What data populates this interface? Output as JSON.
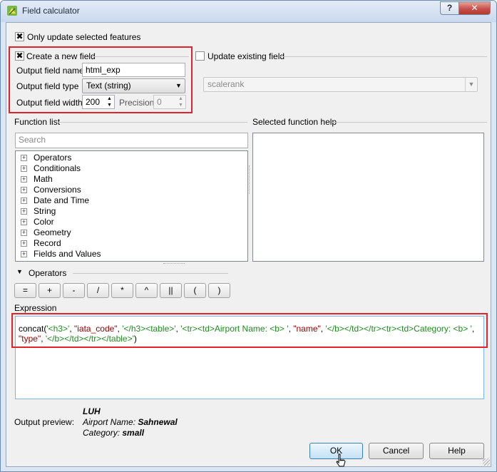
{
  "window": {
    "title": "Field calculator",
    "help_label": "?",
    "close_label": "✕"
  },
  "top": {
    "only_selected_label": "Only update selected features",
    "only_selected_checked": true
  },
  "new_field": {
    "create_label": "Create a new field",
    "checked": true,
    "name_label": "Output field name",
    "name_value": "html_exp",
    "type_label": "Output field type",
    "type_value": "Text (string)",
    "width_label": "Output field width",
    "width_value": "200",
    "precision_label": "Precision",
    "precision_value": "0"
  },
  "update_existing": {
    "label": "Update existing field",
    "checked": false,
    "field_value": "scalerank"
  },
  "function_list": {
    "title": "Function list",
    "search_placeholder": "Search",
    "items": [
      {
        "label": "Operators"
      },
      {
        "label": "Conditionals"
      },
      {
        "label": "Math"
      },
      {
        "label": "Conversions"
      },
      {
        "label": "Date and Time"
      },
      {
        "label": "String"
      },
      {
        "label": "Color"
      },
      {
        "label": "Geometry"
      },
      {
        "label": "Record"
      },
      {
        "label": "Fields and Values"
      }
    ]
  },
  "function_help": {
    "title": "Selected function help"
  },
  "operators": {
    "title": "Operators",
    "buttons": [
      "=",
      "+",
      "-",
      "/",
      "*",
      "^",
      "||",
      "(",
      ")"
    ]
  },
  "expression": {
    "title": "Expression",
    "tokens_line1": [
      {
        "t": "concat(",
        "k": "fn"
      },
      {
        "t": "'<h3>'",
        "k": "str"
      },
      {
        "t": ", ",
        "k": "fn"
      },
      {
        "t": "\"iata_code\"",
        "k": "ident"
      },
      {
        "t": ", ",
        "k": "fn"
      },
      {
        "t": "'</h3><table>'",
        "k": "str"
      },
      {
        "t": ", ",
        "k": "fn"
      },
      {
        "t": "'<tr><td>Airport Name: <b> '",
        "k": "str"
      },
      {
        "t": ", ",
        "k": "fn"
      },
      {
        "t": "\"name\"",
        "k": "ident"
      },
      {
        "t": ", ",
        "k": "fn"
      },
      {
        "t": "'</b></td></tr><tr><td>Category: <b> '",
        "k": "str"
      },
      {
        "t": ",",
        "k": "fn"
      }
    ],
    "tokens_line2": [
      {
        "t": "\"type\"",
        "k": "ident"
      },
      {
        "t": ", ",
        "k": "fn"
      },
      {
        "t": "'</b></td></tr></table>'",
        "k": "str"
      },
      {
        "t": ")",
        "k": "fn"
      }
    ]
  },
  "preview": {
    "label": "Output preview:",
    "line1": "LUH",
    "line2_label": "Airport Name: ",
    "line2_value": "Sahnewal",
    "line3_label": "Category: ",
    "line3_value": "small"
  },
  "buttons": {
    "ok": "OK",
    "cancel": "Cancel",
    "help": "Help"
  },
  "colors": {
    "highlight": "#e0242b",
    "string": "#1f8a1f",
    "field": "#8b0000"
  }
}
